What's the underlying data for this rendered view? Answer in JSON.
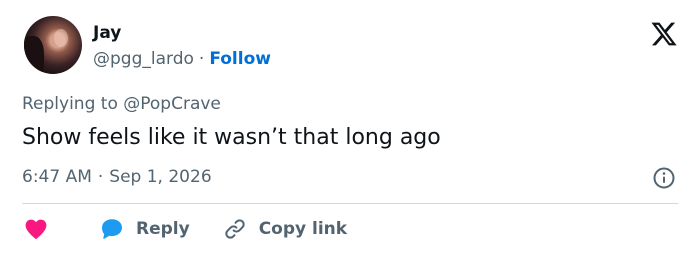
{
  "author": {
    "name": "Jay",
    "handle": "@pgg_lardo",
    "separator": "·",
    "follow_label": "Follow"
  },
  "brand_icon": "x-logo-icon",
  "reply_context": {
    "prefix": "Replying to",
    "mention": "@PopCrave"
  },
  "tweet": {
    "text": "Show feels like it wasn’t that long ago",
    "time": "6:47 AM",
    "separator": "·",
    "date": "Sep 1, 2026"
  },
  "actions": {
    "like_icon": "heart-icon",
    "reply_label": "Reply",
    "reply_icon": "speech-bubble-icon",
    "copy_label": "Copy link",
    "copy_icon": "link-icon"
  },
  "colors": {
    "accent": "#006fd6",
    "like": "#f91880",
    "reply": "#1d9bf0",
    "muted": "#536471",
    "text": "#0f1419",
    "divider": "#cfd9de"
  }
}
